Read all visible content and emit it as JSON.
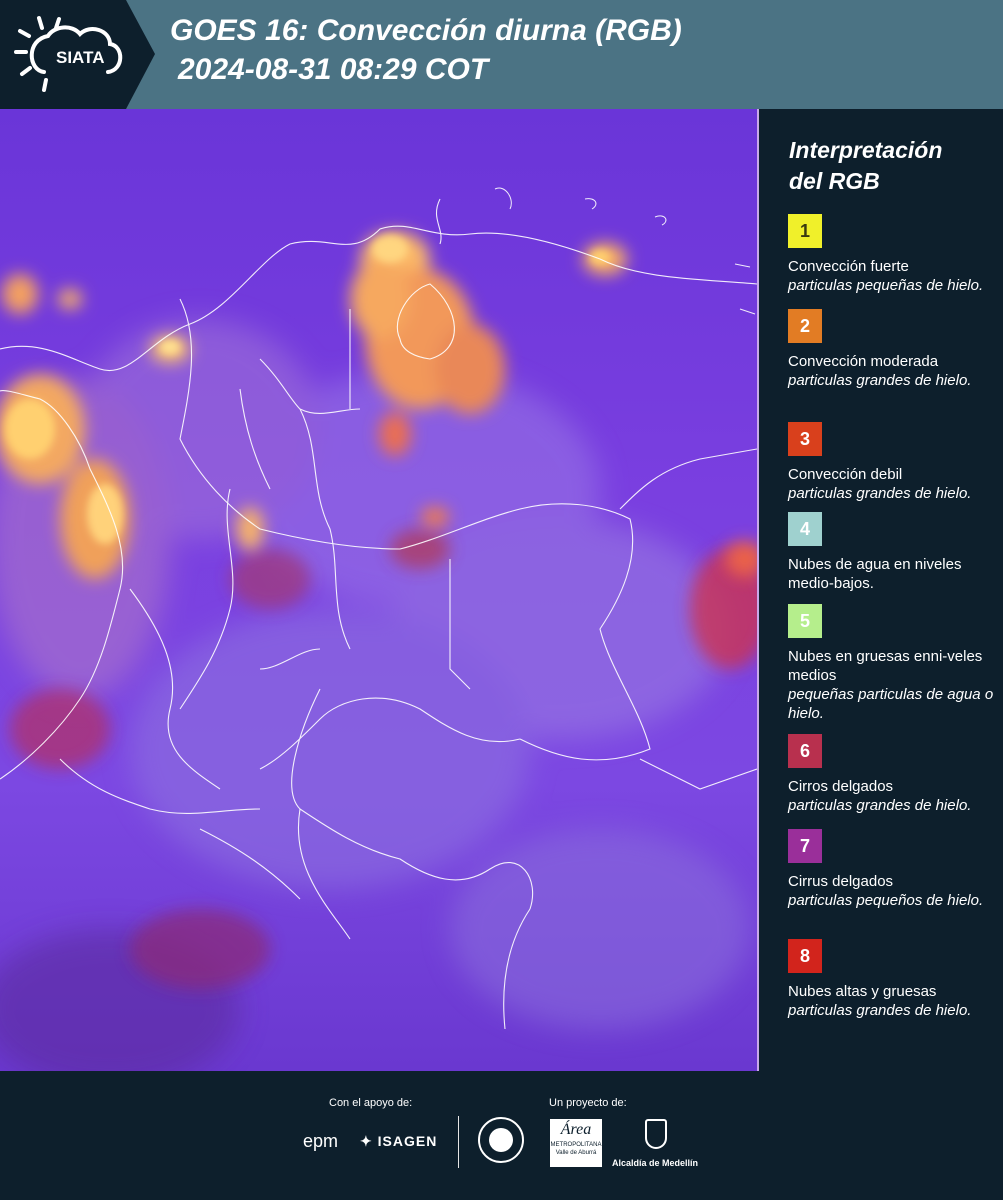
{
  "header": {
    "logo_text": "SIATA",
    "title_line1": "GOES 16: Convección diurna (RGB)",
    "title_line2": "2024-08-31 08:29 COT"
  },
  "legend": {
    "title_line1": "Interpretación",
    "title_line2": "del RGB",
    "items": [
      {
        "number": "1",
        "color": "#f0f02a",
        "text_color": "#3a3a10",
        "name": "Convección fuerte",
        "desc": "particulas pequeñas de hielo."
      },
      {
        "number": "2",
        "color": "#e27c24",
        "text_color": "#ffffff",
        "name": "Convección moderada",
        "desc": "particulas grandes de hielo."
      },
      {
        "number": "3",
        "color": "#d9401c",
        "text_color": "#ffffff",
        "name": "Convección debil",
        "desc": "particulas grandes de hielo."
      },
      {
        "number": "4",
        "color": "#9fd1cf",
        "text_color": "#ffffff",
        "name": "Nubes de agua en niveles medio-bajos.",
        "desc": ""
      },
      {
        "number": "5",
        "color": "#b5ee8c",
        "text_color": "#ffffff",
        "name": "Nubes en gruesas enni-veles medios",
        "desc": "pequeñas particulas de agua o hielo."
      },
      {
        "number": "6",
        "color": "#b8304e",
        "text_color": "#ffffff",
        "name": "Cirros delgados",
        "desc": "particulas grandes de hielo."
      },
      {
        "number": "7",
        "color": "#9a2f9a",
        "text_color": "#ffffff",
        "name": "Cirrus delgados",
        "desc": "particulas pequeños de hielo."
      },
      {
        "number": "8",
        "color": "#d2241c",
        "text_color": "#ffffff",
        "name": "Nubes altas y gruesas",
        "desc": "particulas grandes de hielo."
      }
    ]
  },
  "footer": {
    "support_label": "Con el apoyo de:",
    "project_label": "Un proyecto de:",
    "logos": [
      "epm",
      "ISAGEN",
      "Área Metropolitana Valle de Aburrá",
      "Alcaldía de Medellín"
    ],
    "metro_text": "METROPOLITANA",
    "metro_sub": "Valle de Aburrá",
    "alcaldia_text": "Alcaldía de Medellín"
  }
}
